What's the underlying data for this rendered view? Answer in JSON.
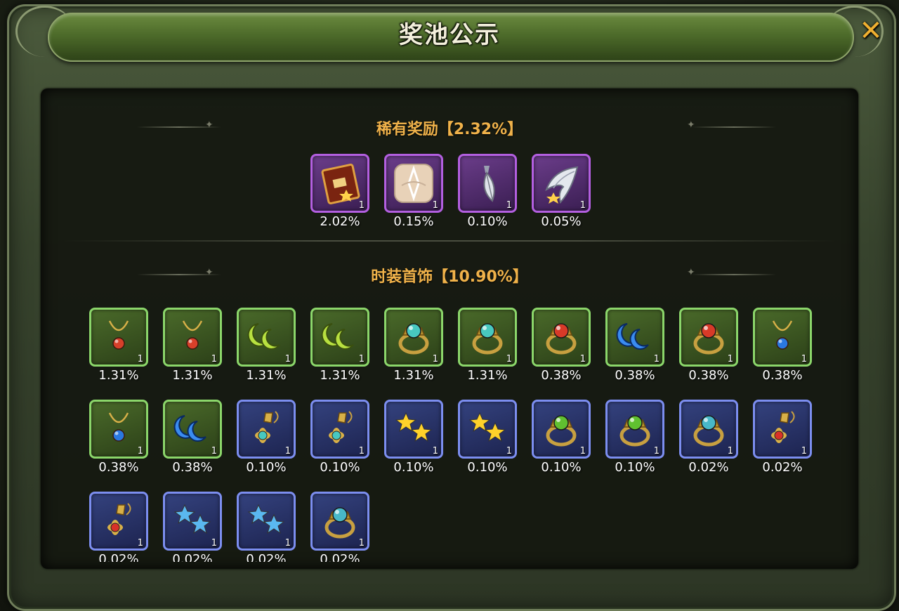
{
  "header": {
    "title": "奖池公示",
    "close_icon": "close-icon"
  },
  "sections": [
    {
      "title": "稀有奖励【2.32%】"
    },
    {
      "title": "时装首饰【10.90%】"
    }
  ],
  "rare_items": [
    {
      "icon": "card-icon",
      "count": "1",
      "pct": "2.02%",
      "rarity": "purple"
    },
    {
      "icon": "emblem-icon",
      "count": "1",
      "pct": "0.15%",
      "rarity": "purple"
    },
    {
      "icon": "feather-icon",
      "count": "1",
      "pct": "0.10%",
      "rarity": "purple"
    },
    {
      "icon": "wing-icon",
      "count": "1",
      "pct": "0.05%",
      "rarity": "purple"
    }
  ],
  "accessory_items": [
    {
      "icon": "red-necklace-icon",
      "count": "1",
      "pct": "1.31%",
      "rarity": "green"
    },
    {
      "icon": "red-necklace-icon",
      "count": "1",
      "pct": "1.31%",
      "rarity": "green"
    },
    {
      "icon": "green-moon-earring-icon",
      "count": "1",
      "pct": "1.31%",
      "rarity": "green"
    },
    {
      "icon": "green-moon-earring-icon",
      "count": "1",
      "pct": "1.31%",
      "rarity": "green"
    },
    {
      "icon": "teal-ring-icon",
      "count": "1",
      "pct": "1.31%",
      "rarity": "green"
    },
    {
      "icon": "teal-ring-icon",
      "count": "1",
      "pct": "1.31%",
      "rarity": "green"
    },
    {
      "icon": "red-ring-icon",
      "count": "1",
      "pct": "0.38%",
      "rarity": "green"
    },
    {
      "icon": "blue-moon-earring-icon",
      "count": "1",
      "pct": "0.38%",
      "rarity": "green"
    },
    {
      "icon": "red-ring-icon",
      "count": "1",
      "pct": "0.38%",
      "rarity": "green"
    },
    {
      "icon": "blue-necklace-icon",
      "count": "1",
      "pct": "0.38%",
      "rarity": "green"
    },
    {
      "icon": "blue-necklace-icon",
      "count": "1",
      "pct": "0.38%",
      "rarity": "green"
    },
    {
      "icon": "blue-moon-earring-icon",
      "count": "1",
      "pct": "0.38%",
      "rarity": "green"
    },
    {
      "icon": "flower-pendant-icon",
      "count": "1",
      "pct": "0.10%",
      "rarity": "blue"
    },
    {
      "icon": "flower-pendant-icon",
      "count": "1",
      "pct": "0.10%",
      "rarity": "blue"
    },
    {
      "icon": "gold-star-earring-icon",
      "count": "1",
      "pct": "0.10%",
      "rarity": "blue"
    },
    {
      "icon": "gold-star-earring-icon",
      "count": "1",
      "pct": "0.10%",
      "rarity": "blue"
    },
    {
      "icon": "green-ring-icon",
      "count": "1",
      "pct": "0.10%",
      "rarity": "blue"
    },
    {
      "icon": "green-ring-icon",
      "count": "1",
      "pct": "0.10%",
      "rarity": "blue"
    },
    {
      "icon": "aqua-ring-icon",
      "count": "1",
      "pct": "0.02%",
      "rarity": "blue"
    },
    {
      "icon": "red-flower-pendant-icon",
      "count": "1",
      "pct": "0.02%",
      "rarity": "blue"
    },
    {
      "icon": "red-flower-pendant-icon",
      "count": "1",
      "pct": "0.02%",
      "rarity": "blue"
    },
    {
      "icon": "blue-star-earring-icon",
      "count": "1",
      "pct": "0.02%",
      "rarity": "blue"
    },
    {
      "icon": "blue-star-earring-icon",
      "count": "1",
      "pct": "0.02%",
      "rarity": "blue"
    },
    {
      "icon": "aqua-ring-icon",
      "count": "1",
      "pct": "0.02%",
      "rarity": "blue"
    }
  ]
}
